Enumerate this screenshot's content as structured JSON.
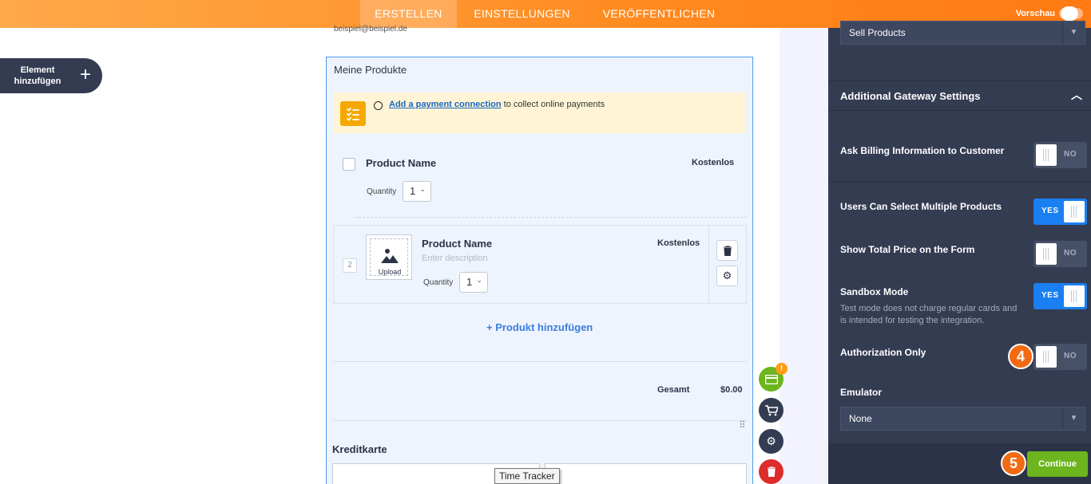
{
  "topbar": {
    "tabs": [
      {
        "label": "ERSTELLEN",
        "active": true
      },
      {
        "label": "EINSTELLUNGEN",
        "active": false
      },
      {
        "label": "VERÖFFENTLICHEN",
        "active": false
      }
    ],
    "preview_label": "Vorschau",
    "preview_on": false
  },
  "left": {
    "add_element_label": "Element hinzufügen",
    "add_icon": "plus-icon"
  },
  "form": {
    "sample_email": "beispiel@beispiel.de",
    "widget_title": "Meine Produkte",
    "notice": {
      "icon": "checklist-icon",
      "link_text": "Add a payment connection",
      "text": " to collect online payments"
    },
    "products": [
      {
        "name": "Product Name",
        "price": "Kostenlos",
        "quantity_label": "Quantity",
        "quantity": "1"
      },
      {
        "index": "2",
        "name": "Product Name",
        "price": "Kostenlos",
        "description_placeholder": "Enter description",
        "upload_label": "Upload",
        "quantity_label": "Quantity",
        "quantity": "1"
      }
    ],
    "add_product_label": "+ Produkt hinzufügen",
    "total_label": "Gesamt",
    "total_value": "$0.00",
    "credit_card_title": "Kreditkarte",
    "tooltip": "Time Tracker",
    "fab_badge": "!"
  },
  "panel": {
    "top_select_value": "Sell Products",
    "section_title": "Additional Gateway Settings",
    "options": [
      {
        "label": "Ask Billing Information to Customer",
        "state": "NO",
        "on": false
      },
      {
        "label": "Users Can Select Multiple Products",
        "state": "YES",
        "on": true
      },
      {
        "label": "Show Total Price on the Form",
        "state": "NO",
        "on": false
      },
      {
        "label": "Sandbox Mode",
        "state": "YES",
        "on": true,
        "description": "Test mode does not charge regular cards and is intended for testing the integration."
      },
      {
        "label": "Authorization Only",
        "state": "NO",
        "on": false
      }
    ],
    "emulator_label": "Emulator",
    "emulator_value": "None",
    "continue_label": "Continue",
    "step_markers": [
      "4",
      "5"
    ]
  },
  "colors": {
    "accent_orange": "#ff8a1f",
    "panel_bg": "#343c52",
    "toggle_on": "#1a7ff0",
    "continue_green": "#6cb51e",
    "delete_red": "#de2b2b"
  }
}
